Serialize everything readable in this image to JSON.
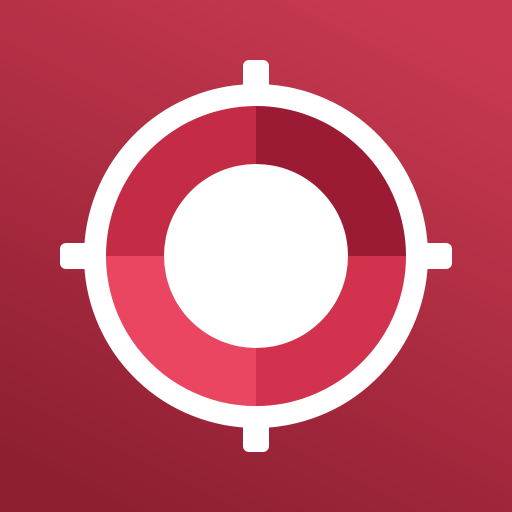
{
  "icon": {
    "name": "crosshair-target-icon",
    "colors": {
      "background_light": "#C8394F",
      "background_dark": "#8E1F32",
      "ring": "#FFFFFF",
      "quadrant_top_right": "#9A1B33",
      "quadrant_top_left": "#C42C46",
      "quadrant_bottom_left": "#EA4661",
      "quadrant_bottom_right": "#D2324D",
      "center": "#FFFFFF"
    }
  }
}
